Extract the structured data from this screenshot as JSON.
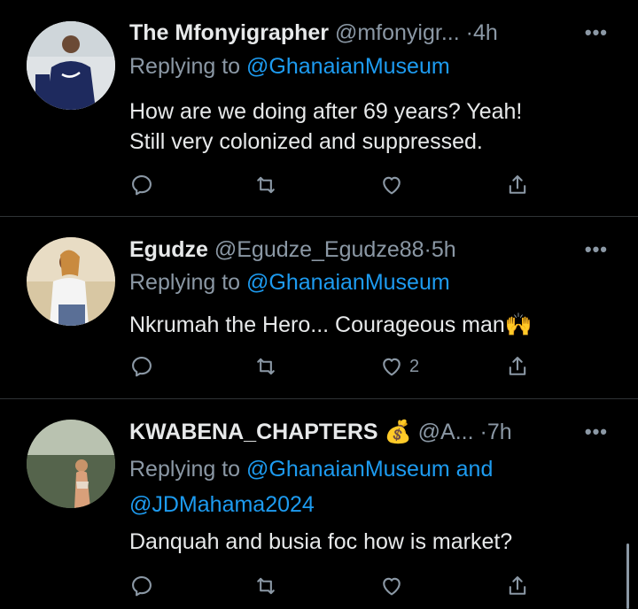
{
  "tweets": [
    {
      "name": "The Mfonyigrapher",
      "handle": "@mfonyigr...",
      "dot": "·",
      "time": "4h",
      "replying_prefix": "Replying to",
      "replying_to": "@GhanaianMuseum",
      "text_line1": "How are we doing after 69 years? Yeah!",
      "text_line2": "Still very colonized and suppressed.",
      "likes": ""
    },
    {
      "name": "Egudze",
      "handle": "@Egudze_Egudze88",
      "dot": "·",
      "time": "5h",
      "replying_prefix": "Replying to",
      "replying_to": "@GhanaianMuseum",
      "text_line1": "Nkrumah the Hero... Courageous man🙌",
      "likes": "2"
    },
    {
      "name": "KWABENA_CHAPTERS",
      "emoji": "💰",
      "handle": "@A...",
      "dot": "·",
      "time": "7h",
      "replying_prefix": "Replying to",
      "replying_to": "@GhanaianMuseum",
      "replying_and": "and",
      "replying_to2": "@JDMahama2024",
      "text_line1": "Danquah and busia foc how is market?",
      "likes": ""
    }
  ],
  "more_label": "•••",
  "icons": [
    "reply-icon",
    "retweet-icon",
    "like-icon",
    "share-icon"
  ]
}
